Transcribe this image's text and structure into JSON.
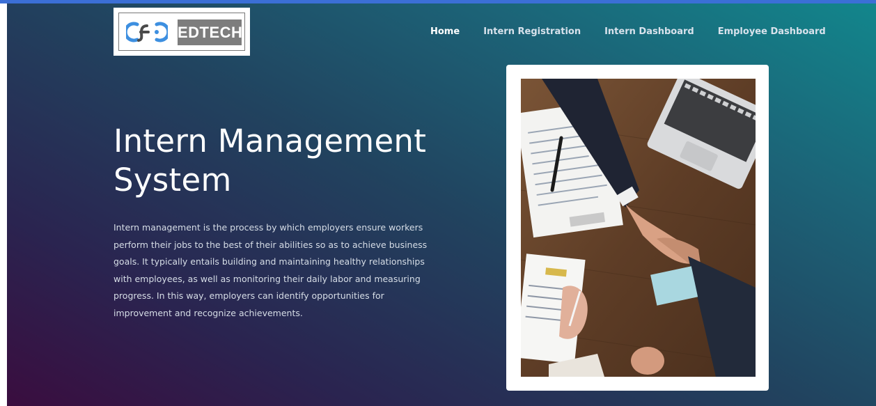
{
  "logo": {
    "text": "EDTECH"
  },
  "nav": {
    "items": [
      {
        "label": "Home",
        "active": true
      },
      {
        "label": "Intern Registration",
        "active": false
      },
      {
        "label": "Intern Dashboard",
        "active": false
      },
      {
        "label": "Employee Dashboard",
        "active": false
      }
    ]
  },
  "hero": {
    "title": "Intern Management System",
    "description": "Intern management is the process by which employers ensure workers perform their jobs to the best of their abilities so as to achieve business goals. It typically entails building and maintaining healthy relationships with employees, as well as monitoring their daily labor and measuring progress. In this way, employers can identify opportunities for improvement and recognize achievements."
  },
  "colors": {
    "accent_strip": "#3b6fd6",
    "gradient_start": "#3a0d3f",
    "gradient_end": "#12868c",
    "logo_word_bg": "#7d7d7d"
  }
}
